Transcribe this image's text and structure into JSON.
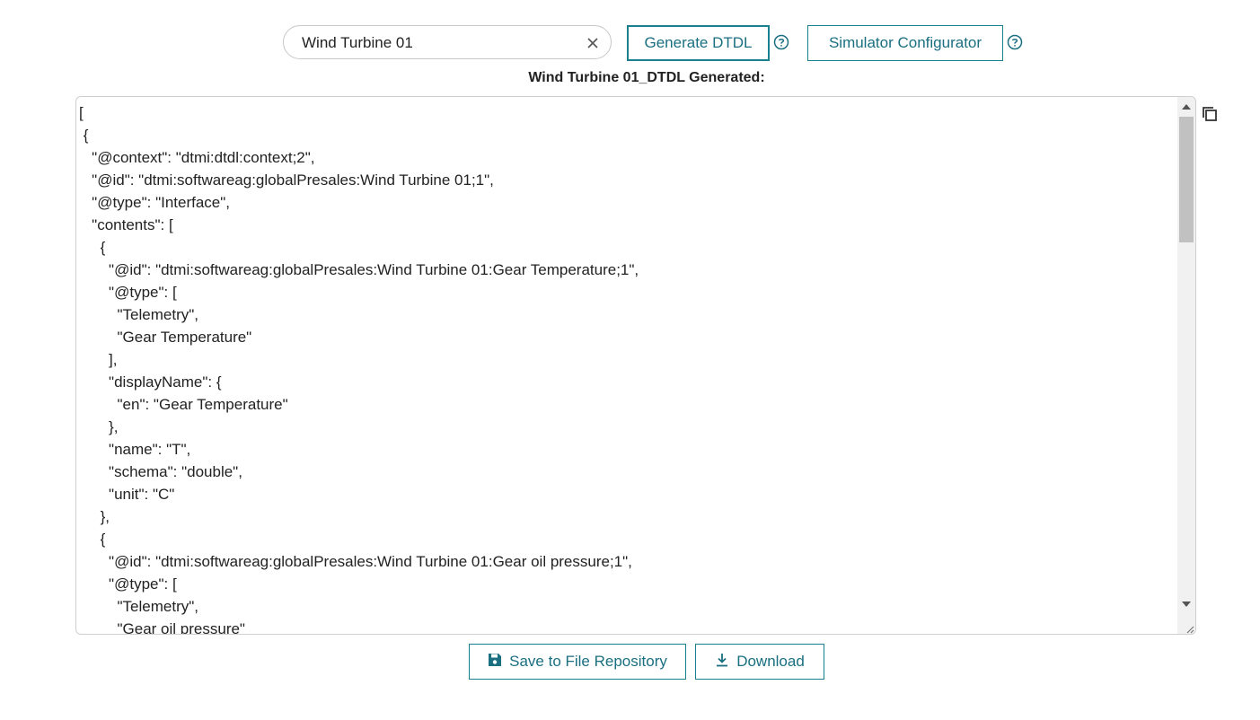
{
  "search": {
    "value": "Wind Turbine 01"
  },
  "buttons": {
    "generate": "Generate DTDL",
    "simulator": "Simulator Configurator",
    "save": "Save to File Repository",
    "download": "Download"
  },
  "result": {
    "title": "Wind Turbine 01_DTDL Generated:",
    "code": "[\n {\n   \"@context\": \"dtmi:dtdl:context;2\",\n   \"@id\": \"dtmi:softwareag:globalPresales:Wind Turbine 01;1\",\n   \"@type\": \"Interface\",\n   \"contents\": [\n     {\n       \"@id\": \"dtmi:softwareag:globalPresales:Wind Turbine 01:Gear Temperature;1\",\n       \"@type\": [\n         \"Telemetry\",\n         \"Gear Temperature\"\n       ],\n       \"displayName\": {\n         \"en\": \"Gear Temperature\"\n       },\n       \"name\": \"T\",\n       \"schema\": \"double\",\n       \"unit\": \"C\"\n     },\n     {\n       \"@id\": \"dtmi:softwareag:globalPresales:Wind Turbine 01:Gear oil pressure;1\",\n       \"@type\": [\n         \"Telemetry\",\n         \"Gear oil pressure\""
  },
  "colors": {
    "accent": "#1a7f8e"
  },
  "icons": {
    "clear": "close-icon",
    "help": "help-circle-icon",
    "copy": "copy-icon",
    "save": "floppy-disk-icon",
    "download": "download-icon"
  }
}
